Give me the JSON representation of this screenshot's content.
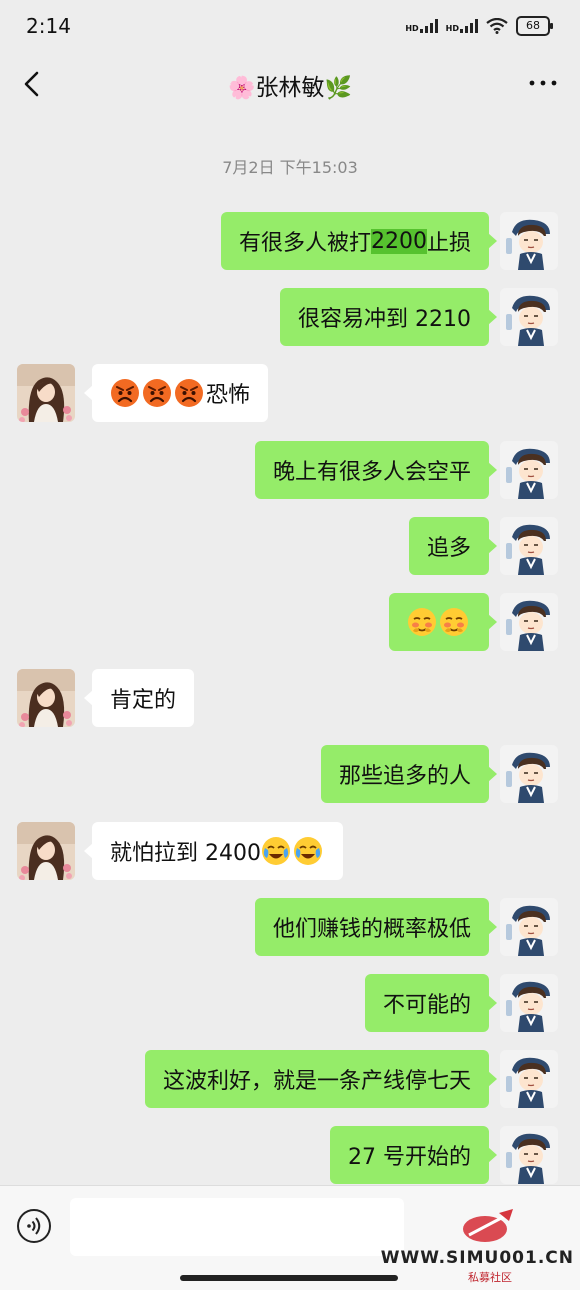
{
  "status": {
    "time": "2:14",
    "battery": "68",
    "signal_label_1": "HD",
    "signal_label_2": "HD"
  },
  "header": {
    "title": "张林敏",
    "title_prefix": "🌸",
    "title_suffix": "🌿"
  },
  "timestamp": "7月2日 下午15:03",
  "messages": [
    {
      "side": "out",
      "parts": [
        {
          "text": "有很多人被打"
        },
        {
          "text": "2200",
          "highlight": true
        },
        {
          "text": "止损"
        }
      ]
    },
    {
      "side": "out",
      "parts": [
        {
          "text": "很容易冲到 2210"
        }
      ]
    },
    {
      "side": "in",
      "parts": [
        {
          "emoji": "angry-face"
        },
        {
          "emoji": "angry-face"
        },
        {
          "emoji": "angry-face"
        },
        {
          "text": "恐怖"
        }
      ]
    },
    {
      "side": "out",
      "parts": [
        {
          "text": "晚上有很多人会空平"
        }
      ]
    },
    {
      "side": "out",
      "parts": [
        {
          "text": "追多"
        }
      ]
    },
    {
      "side": "out",
      "parts": [
        {
          "emoji": "blush-face"
        },
        {
          "emoji": "blush-face"
        }
      ]
    },
    {
      "side": "in",
      "parts": [
        {
          "text": "肯定的"
        }
      ]
    },
    {
      "side": "out",
      "parts": [
        {
          "text": "那些追多的人"
        }
      ]
    },
    {
      "side": "in",
      "parts": [
        {
          "text": "就怕拉到 2400"
        },
        {
          "emoji": "laugh-cry-face"
        },
        {
          "emoji": "laugh-cry-face"
        }
      ]
    },
    {
      "side": "out",
      "parts": [
        {
          "text": "他们赚钱的概率极低"
        }
      ]
    },
    {
      "side": "out",
      "parts": [
        {
          "text": "不可能的"
        }
      ]
    },
    {
      "side": "out",
      "parts": [
        {
          "text": "这波利好，就是一条产线停七天"
        }
      ]
    },
    {
      "side": "out",
      "parts": [
        {
          "text": "27 号开始的"
        }
      ]
    }
  ],
  "input": {
    "placeholder": ""
  },
  "watermark": {
    "site": "WWW.SIMU001.CN",
    "sub": "私募社区"
  },
  "colors": {
    "background": "#ededed",
    "bubble_out": "#95ec69",
    "bubble_in": "#ffffff",
    "highlight": "#56c22f"
  },
  "icons": {
    "back": "chevron-left-icon",
    "more": "more-dots-icon",
    "voice": "voice-icon"
  }
}
